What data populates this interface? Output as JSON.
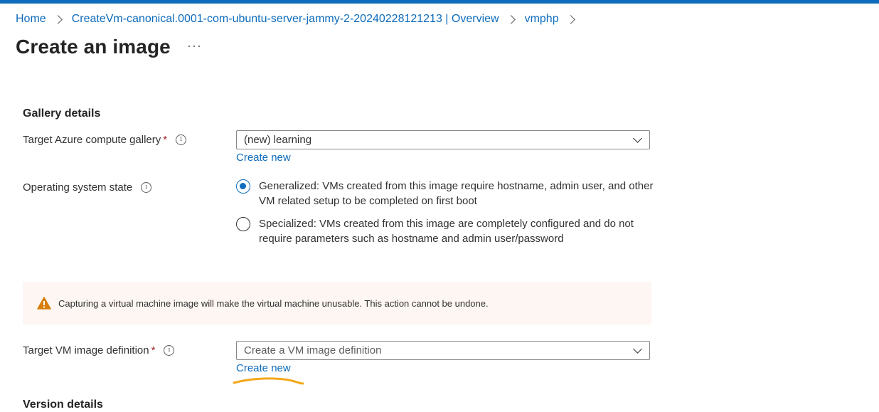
{
  "breadcrumb": {
    "items": [
      "Home",
      "CreateVm-canonical.0001-com-ubuntu-server-jammy-2-20240228121213 | Overview",
      "vmphp"
    ]
  },
  "page": {
    "title": "Create an image",
    "more_label": "···"
  },
  "gallery_details": {
    "title": "Gallery details",
    "target_gallery": {
      "label": "Target Azure compute gallery",
      "required_mark": "*",
      "value": "(new) learning",
      "create_new": "Create new"
    },
    "os_state": {
      "label": "Operating system state",
      "options": [
        {
          "text": "Generalized: VMs created from this image require hostname, admin user, and other VM related setup to be completed on first boot",
          "selected": true
        },
        {
          "text": "Specialized: VMs created from this image are completely configured and do not require parameters such as hostname and admin user/password",
          "selected": false
        }
      ]
    }
  },
  "warning": {
    "text": "Capturing a virtual machine image will make the virtual machine unusable. This action cannot be undone.",
    "icon": "warning-triangle-icon"
  },
  "target_image_definition": {
    "label": "Target VM image definition",
    "required_mark": "*",
    "placeholder": "Create a VM image definition",
    "create_new": "Create new"
  },
  "version_details": {
    "title": "Version details"
  },
  "colors": {
    "accent": "#0f6cbd",
    "required": "#a4262c",
    "warning_bg": "#fdf6f3",
    "warning_icon": "#d67f0c",
    "annotation": "#f4a81c"
  }
}
